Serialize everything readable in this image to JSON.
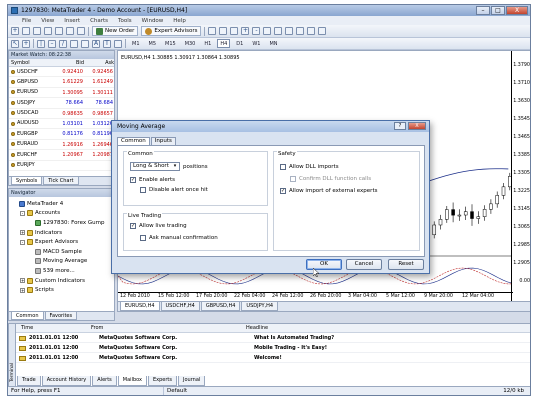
{
  "window": {
    "title": "1297830: MetaTrader 4 - Demo Account - [EURUSD,H4]",
    "min": "–",
    "max": "□",
    "close": "X"
  },
  "menu": [
    "File",
    "View",
    "Insert",
    "Charts",
    "Tools",
    "Window",
    "Help"
  ],
  "toolbar": {
    "new_order": "New Order",
    "expert_advisors": "Expert Advisors",
    "timeframes": [
      "M1",
      "M5",
      "M15",
      "M30",
      "H1",
      "H4",
      "D1",
      "W1",
      "MN"
    ],
    "active_tf": "H4",
    "text_tool": "A",
    "tf_tool": "T"
  },
  "market_watch": {
    "title": "Market Watch: 08:22:38",
    "columns": {
      "symbol": "Symbol",
      "bid": "Bid",
      "ask": "Ask"
    },
    "rows": [
      {
        "symbol": "USDCHF",
        "bid": "0.92410",
        "ask": "0.92456",
        "dir": "dn"
      },
      {
        "symbol": "GBPUSD",
        "bid": "1.61229",
        "ask": "1.61249",
        "dir": "dn"
      },
      {
        "symbol": "EURUSD",
        "bid": "1.30095",
        "ask": "1.30111",
        "dir": "dn"
      },
      {
        "symbol": "USDJPY",
        "bid": "78.664",
        "ask": "78.684",
        "dir": "up"
      },
      {
        "symbol": "USDCAD",
        "bid": "0.98635",
        "ask": "0.98657",
        "dir": "dn"
      },
      {
        "symbol": "AUDUSD",
        "bid": "1.03101",
        "ask": "1.03126",
        "dir": "up"
      },
      {
        "symbol": "EURGBP",
        "bid": "0.81176",
        "ask": "0.81196",
        "dir": "up"
      },
      {
        "symbol": "EURAUD",
        "bid": "1.26916",
        "ask": "1.26946",
        "dir": "dn"
      },
      {
        "symbol": "EURCHF",
        "bid": "1.20967",
        "ask": "1.20987",
        "dir": "dn"
      },
      {
        "symbol": "EURJPY",
        "bid": "",
        "ask": "",
        "dir": "dn"
      }
    ],
    "tabs": [
      "Symbols",
      "Tick Chart"
    ]
  },
  "navigator": {
    "title": "Navigator",
    "items": [
      {
        "label": "MetaTrader 4",
        "level": 0,
        "exp": "",
        "icon": "blue"
      },
      {
        "label": "Accounts",
        "level": 1,
        "exp": "-",
        "icon": "yellow"
      },
      {
        "label": "1297830: Forex Gump",
        "level": 2,
        "exp": "",
        "icon": "green"
      },
      {
        "label": "Indicators",
        "level": 1,
        "exp": "+",
        "icon": "yellow"
      },
      {
        "label": "Expert Advisors",
        "level": 1,
        "exp": "-",
        "icon": "yellow"
      },
      {
        "label": "MACD Sample",
        "level": 2,
        "exp": "",
        "icon": "gray"
      },
      {
        "label": "Moving Average",
        "level": 2,
        "exp": "",
        "icon": "gray"
      },
      {
        "label": "539 more...",
        "level": 2,
        "exp": "",
        "icon": "gray"
      },
      {
        "label": "Custom Indicators",
        "level": 1,
        "exp": "+",
        "icon": "yellow"
      },
      {
        "label": "Scripts",
        "level": 1,
        "exp": "+",
        "icon": "yellow"
      }
    ],
    "tabs": [
      "Common",
      "Favorites"
    ]
  },
  "chart": {
    "info": "EURUSD,H4  1.30885 1.30917 1.30864 1.30895",
    "y_ticks": [
      "1.3790",
      "1.3710",
      "1.3630",
      "1.3545",
      "1.3465",
      "1.3385",
      "1.3305",
      "1.3225",
      "1.3145",
      "1.3065",
      "1.2985",
      "1.2905",
      "0.00"
    ],
    "x_ticks": [
      "12 Feb 2010",
      "15 Feb 12:00",
      "17 Feb 20:00",
      "22 Feb 04:00",
      "24 Feb 12:00",
      "26 Feb 20:00",
      "3 Mar 04:00",
      "5 Mar 12:00",
      "9 Mar 20:00",
      "12 Mar 04:00"
    ],
    "tabs": [
      "EURUSD,H4",
      "USDCHF,H4",
      "GBPUSD,H4",
      "USDJPY,H4"
    ]
  },
  "dialog": {
    "title": "Moving Average",
    "help": "?",
    "close": "X",
    "tabs": [
      "Common",
      "Inputs"
    ],
    "common_group": "Common",
    "positions_value": "Long & Short",
    "positions_label": "positions",
    "enable_alerts": "Enable alerts",
    "disable_alert_once": "Disable alert once hit",
    "live_group": "Live Trading",
    "allow_live": "Allow live trading",
    "ask_manual": "Ask manual confirmation",
    "safety_group": "Safety",
    "allow_dll": "Allow DLL imports",
    "confirm_dll": "Confirm DLL function calls",
    "allow_external": "Allow import of external experts",
    "ok": "OK",
    "cancel": "Cancel",
    "reset": "Reset",
    "checked": "✓"
  },
  "terminal": {
    "side_label": "Terminal",
    "columns": {
      "time": "Time",
      "from": "From",
      "headline": "Headline"
    },
    "rows": [
      {
        "time": "2011.01.01 12:00",
        "from": "MetaQuotes Software Corp.",
        "headline": "What Is Automated Trading?"
      },
      {
        "time": "2011.01.01 12:00",
        "from": "MetaQuotes Software Corp.",
        "headline": "Mobile Trading - It's Easy!"
      },
      {
        "time": "2011.01.01 12:00",
        "from": "MetaQuotes Software Corp.",
        "headline": "Welcome!"
      }
    ],
    "tabs": [
      "Trade",
      "Account History",
      "Alerts",
      "Mailbox",
      "Experts",
      "Journal"
    ],
    "active_tab": "Mailbox"
  },
  "status": {
    "help": "For Help, press F1",
    "profile": "Default",
    "traffic": "12/0 kb"
  }
}
